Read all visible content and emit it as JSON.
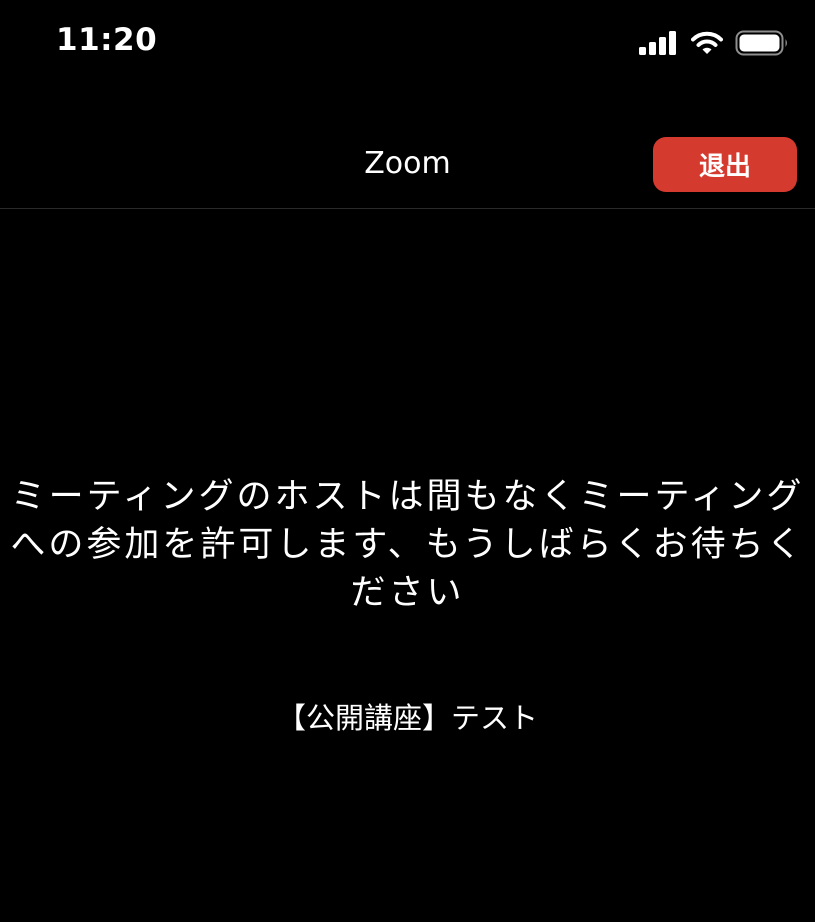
{
  "status_bar": {
    "time": "11:20",
    "icons": [
      "cellular-signal-icon",
      "wifi-icon",
      "battery-icon"
    ]
  },
  "header": {
    "title": "Zoom",
    "leave_label": "退出",
    "leave_color": "#d53a2f"
  },
  "main": {
    "waiting_message": "ミーティングのホストは間もなくミーティングへの参加を許可します、もうしばらくお待ちください",
    "meeting_name": "【公開講座】テスト"
  }
}
